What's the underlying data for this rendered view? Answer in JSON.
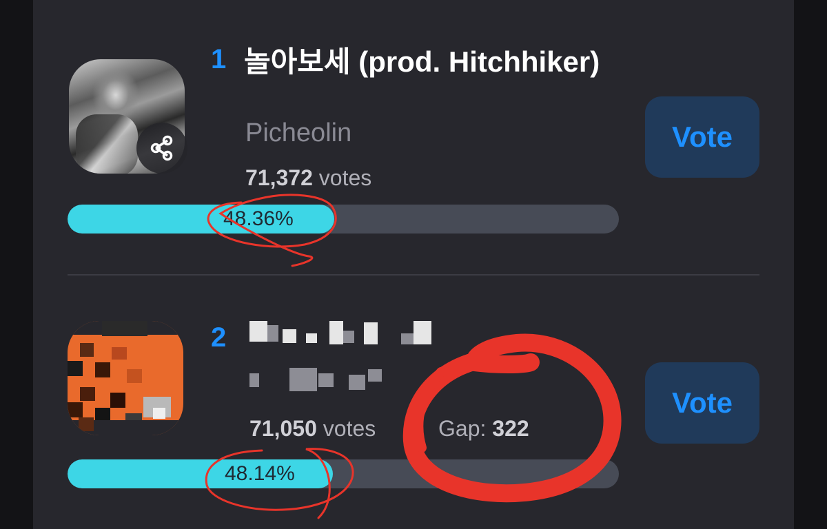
{
  "entries": [
    {
      "rank": "1",
      "title": "놀아보세 (prod. Hitchhiker)",
      "artist": "Picheolin",
      "votes_number": "71,372",
      "votes_label": "votes",
      "percent_text": "48.36%",
      "percent": 48.36,
      "vote_label": "Vote"
    },
    {
      "rank": "2",
      "title": "",
      "artist": "",
      "votes_number": "71,050",
      "votes_label": "votes",
      "gap_label": "Gap:",
      "gap_value": "322",
      "percent_text": "48.14%",
      "percent": 48.14,
      "vote_label": "Vote"
    }
  ],
  "colors": {
    "accent": "#1e90ff",
    "bar_fill": "#3dd6e6",
    "bar_track": "#474b56",
    "annotation": "#e8342a"
  },
  "icons": [
    "share-icon"
  ]
}
